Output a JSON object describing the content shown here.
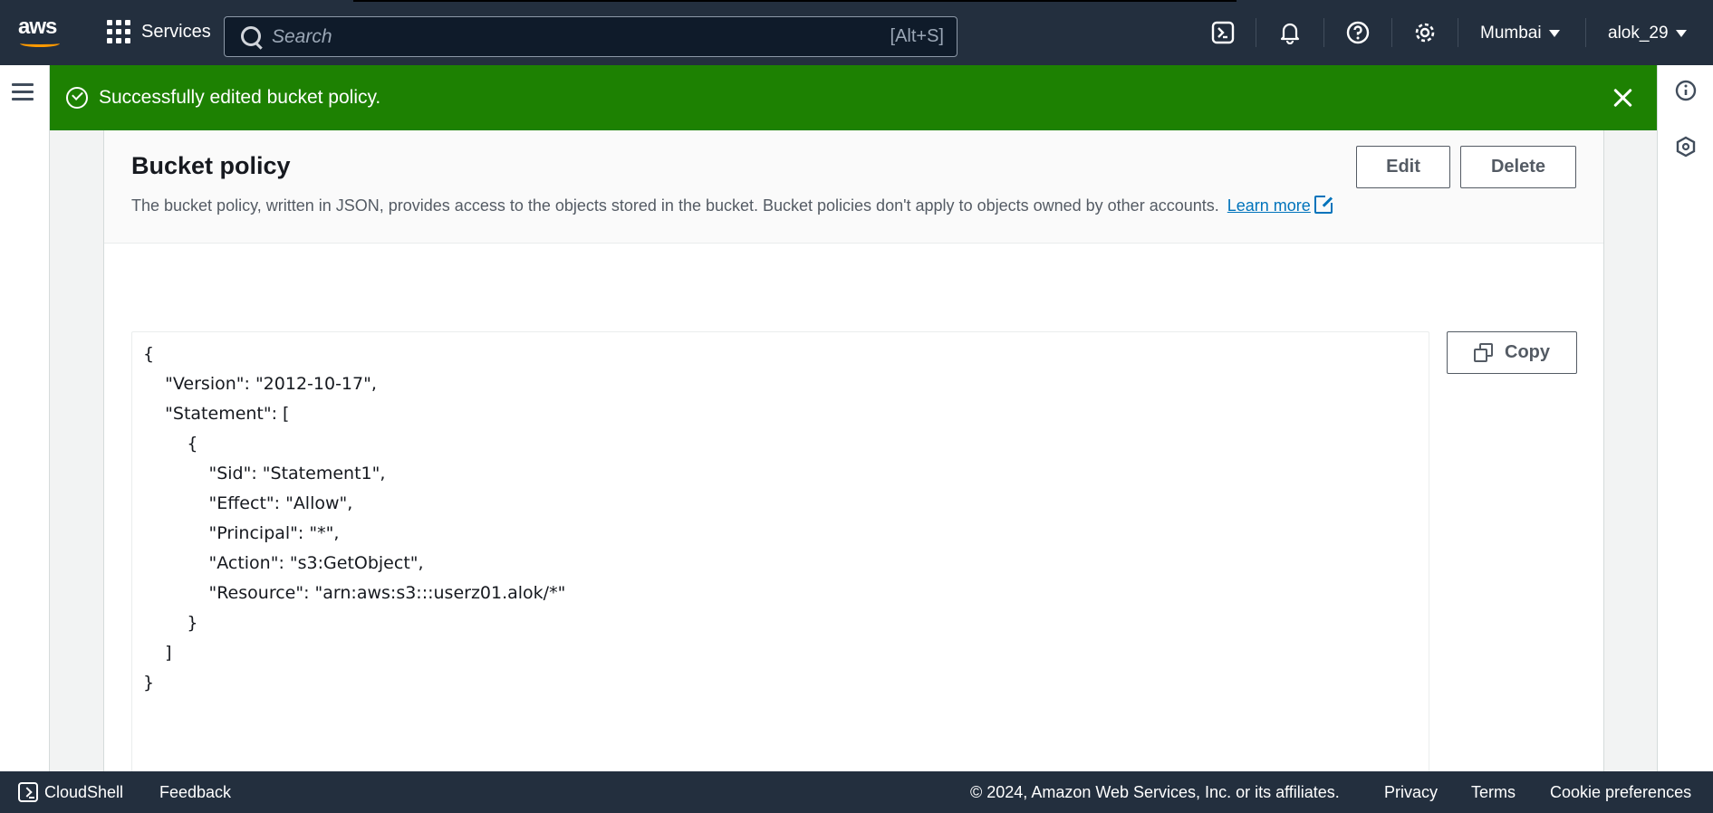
{
  "topnav": {
    "logo": "aws",
    "services_label": "Services",
    "search_placeholder": "Search",
    "search_shortcut": "[Alt+S]",
    "region": "Mumbai",
    "user": "alok_29",
    "icons": [
      "cloudshell-icon",
      "bell-icon",
      "help-icon",
      "gear-icon"
    ]
  },
  "flash": {
    "message": "Successfully edited bucket policy.",
    "color": "#1d8102"
  },
  "panel": {
    "title": "Bucket policy",
    "description": "The bucket policy, written in JSON, provides access to the objects stored in the bucket. Bucket policies don't apply to objects owned by other accounts.",
    "learn_more": "Learn more",
    "edit_label": "Edit",
    "delete_label": "Delete",
    "copy_label": "Copy",
    "policy_json": "{\n    \"Version\": \"2012-10-17\",\n    \"Statement\": [\n        {\n            \"Sid\": \"Statement1\",\n            \"Effect\": \"Allow\",\n            \"Principal\": \"*\",\n            \"Action\": \"s3:GetObject\",\n            \"Resource\": \"arn:aws:s3:::userz01.alok/*\"\n        }\n    ]\n}"
  },
  "footer": {
    "cloudshell": "CloudShell",
    "feedback": "Feedback",
    "copyright": "© 2024, Amazon Web Services, Inc. or its affiliates.",
    "privacy": "Privacy",
    "terms": "Terms",
    "cookie": "Cookie preferences"
  }
}
